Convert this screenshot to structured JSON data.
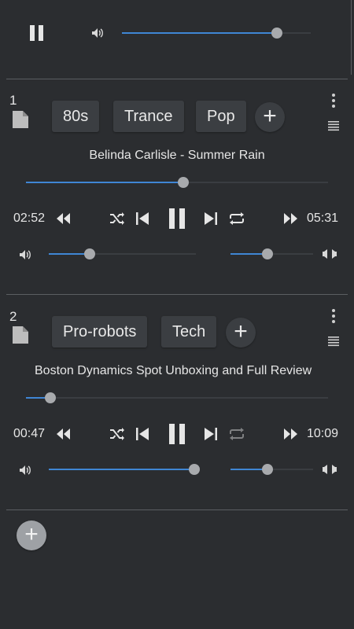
{
  "global": {
    "play_pause_icon": "pause-icon",
    "volume_icon": "volume-icon",
    "master_volume": 0.82
  },
  "players": [
    {
      "number": "1",
      "tags": [
        "80s",
        "Trance",
        "Pop"
      ],
      "track_title": "Belinda Carlisle - Summer Rain",
      "progress": 0.52,
      "elapsed": "02:52",
      "duration": "05:31",
      "repeat_enabled": true,
      "volume": 0.28,
      "balance": 0.45
    },
    {
      "number": "2",
      "tags": [
        "Pro-robots",
        "Tech"
      ],
      "track_title": "Boston Dynamics Spot Unboxing and Full Review",
      "progress": 0.08,
      "elapsed": "00:47",
      "duration": "10:09",
      "repeat_enabled": false,
      "volume": 0.99,
      "balance": 0.45
    }
  ],
  "colors": {
    "background": "#2b2d30",
    "accent": "#3f86d4",
    "chip": "#3b3e42",
    "knob": "#a8aaad"
  }
}
